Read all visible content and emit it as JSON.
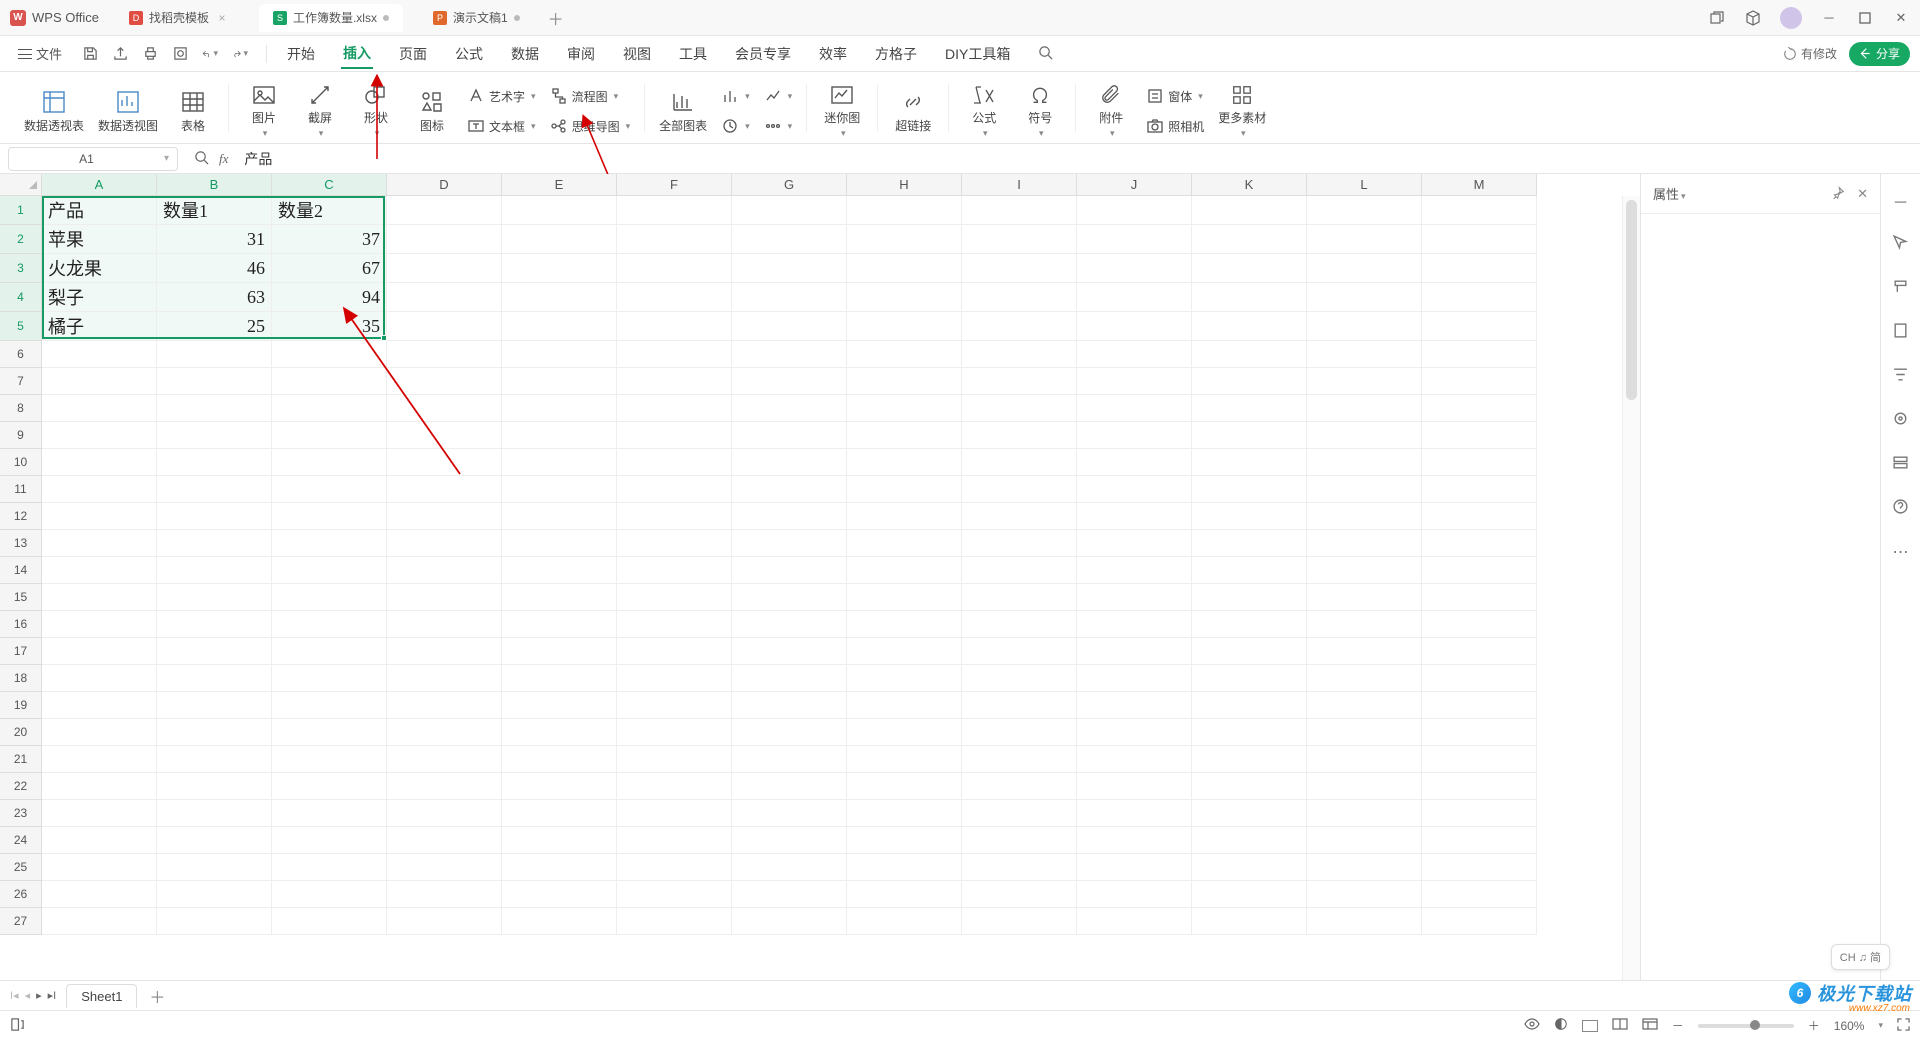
{
  "app": {
    "name": "WPS Office"
  },
  "tabs": [
    {
      "label": "找稻壳模板",
      "iconBg": "#e14d43",
      "iconLetter": "D",
      "dirty": false,
      "closable": true,
      "active": false
    },
    {
      "label": "工作簿数量.xlsx",
      "iconBg": "#1aa366",
      "iconLetter": "S",
      "dirty": true,
      "closable": false,
      "active": true
    },
    {
      "label": "演示文稿1",
      "iconBg": "#e06a2b",
      "iconLetter": "P",
      "dirty": true,
      "closable": false,
      "active": false
    }
  ],
  "fileMenu": {
    "label": "文件"
  },
  "menus": [
    {
      "label": "开始",
      "active": false
    },
    {
      "label": "插入",
      "active": true
    },
    {
      "label": "页面",
      "active": false
    },
    {
      "label": "公式",
      "active": false
    },
    {
      "label": "数据",
      "active": false
    },
    {
      "label": "审阅",
      "active": false
    },
    {
      "label": "视图",
      "active": false
    },
    {
      "label": "工具",
      "active": false
    },
    {
      "label": "会员专享",
      "active": false
    },
    {
      "label": "效率",
      "active": false
    },
    {
      "label": "方格子",
      "active": false
    },
    {
      "label": "DIY工具箱",
      "active": false
    }
  ],
  "topRight": {
    "repair": "有修改",
    "share": "分享"
  },
  "ribbon": {
    "g1": {
      "pivotTable": "数据透视表",
      "pivotChart": "数据透视图",
      "table": "表格"
    },
    "g2": {
      "picture": "图片",
      "screenshot": "截屏",
      "shapes": "形状",
      "icons": "图标",
      "wordart": "艺术字",
      "textbox": "文本框",
      "flowchart": "流程图",
      "mindmap": "思维导图"
    },
    "g3": {
      "allCharts": "全部图表"
    },
    "g4": {
      "sparkline": "迷你图"
    },
    "g5": {
      "hyperlink": "超链接"
    },
    "g6": {
      "formula": "公式",
      "symbol": "符号"
    },
    "g7": {
      "attachment": "附件",
      "form": "窗体",
      "camera": "照相机",
      "moreContent": "更多素材"
    }
  },
  "nameBox": "A1",
  "formulaValue": "产品",
  "cols": [
    "A",
    "B",
    "C",
    "D",
    "E",
    "F",
    "G",
    "H",
    "I",
    "J",
    "K",
    "L",
    "M"
  ],
  "sheet": {
    "headers": [
      "产品",
      "数量1",
      "数量2"
    ],
    "rows": [
      {
        "p": "苹果",
        "q1": 31,
        "q2": 37
      },
      {
        "p": "火龙果",
        "q1": 46,
        "q2": 67
      },
      {
        "p": "梨子",
        "q1": 63,
        "q2": 94
      },
      {
        "p": "橘子",
        "q1": 25,
        "q2": 35
      }
    ]
  },
  "sheetTab": "Sheet1",
  "propertiesPanel": {
    "title": "属性"
  },
  "status": {
    "zoom": "160%"
  },
  "ime": {
    "text": "CH ♫ 简"
  },
  "watermark": {
    "brand": "极光下载站",
    "url": "www.xz7.com"
  },
  "chart_data": {
    "type": "table",
    "title": "",
    "columns": [
      "产品",
      "数量1",
      "数量2"
    ],
    "rows": [
      [
        "苹果",
        31,
        37
      ],
      [
        "火龙果",
        46,
        67
      ],
      [
        "梨子",
        63,
        94
      ],
      [
        "橘子",
        25,
        35
      ]
    ]
  }
}
